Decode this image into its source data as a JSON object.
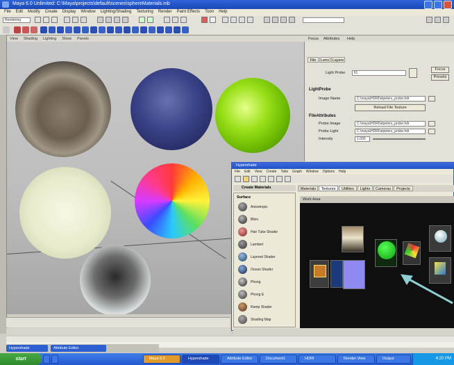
{
  "window": {
    "title": "Maya 6.0 Unlimited: C:\\Maya\\projects\\default\\scenes\\sphereMaterials.mb",
    "menus": [
      "File",
      "Edit",
      "Modify",
      "Create",
      "Display",
      "Window",
      "Lighting/Shading",
      "Texturing",
      "Render",
      "Paint Effects",
      "Toon",
      "Help"
    ]
  },
  "shelf": {
    "mode": "Rendering"
  },
  "viewport": {
    "menus": [
      "View",
      "Shading",
      "Lighting",
      "Show",
      "Panels"
    ]
  },
  "attribute_editor": {
    "tabs": [
      "Focus",
      "Attributes",
      "Help"
    ],
    "sub_tabs": [
      "File",
      "Lens",
      "Layers"
    ],
    "name_label": "Light Probe",
    "name_value": "fi1",
    "focus_btn": "Focus",
    "presets_btn": "Presets",
    "sections": [
      "LightProbe",
      "FileAttributes"
    ],
    "image_label": "Image Name",
    "image_value": "C:\\maya\\HDRI\\stpeters_probe.hdr",
    "reload_btn": "Reload File Texture",
    "probe_rows": [
      "Probe Image",
      "Probe Light",
      "Intensity"
    ],
    "probe_values": [
      "C:\\maya\\HDRI\\stpeters_probe.hdr",
      "C:\\maya\\HDRI\\stpeters_probe.hdr",
      "1.000"
    ]
  },
  "hypershade": {
    "title": "Hypershade",
    "menus": [
      "File",
      "Edit",
      "View",
      "Create",
      "Tabs",
      "Graph",
      "Window",
      "Options",
      "Help"
    ],
    "list_header": "Create Materials",
    "category": "Surface",
    "materials": [
      "Anisotropic",
      "Blinn",
      "Hair Tube Shader",
      "Lambert",
      "Layered Shader",
      "Ocean Shader",
      "Phong",
      "Phong E",
      "Ramp Shader",
      "Shading Map"
    ],
    "tabs": [
      "Materials",
      "Textures",
      "Utilities",
      "Lights",
      "Cameras",
      "Projects"
    ],
    "work_tab": "Work Area"
  },
  "taskbar": {
    "start": "start",
    "tasks": [
      "Maya 6.0",
      "Hypershade",
      "Attribute Editor",
      "Document1",
      "HDRI",
      "Render View",
      "Output",
      "Help"
    ],
    "maya_strip": [
      "Hypershade",
      "Attribute Editor"
    ],
    "clock": "4:20 PM"
  },
  "colors": {
    "title_blue": "#2458d0",
    "arrow": "#8ecfd4",
    "node_green": "#22c21e"
  }
}
